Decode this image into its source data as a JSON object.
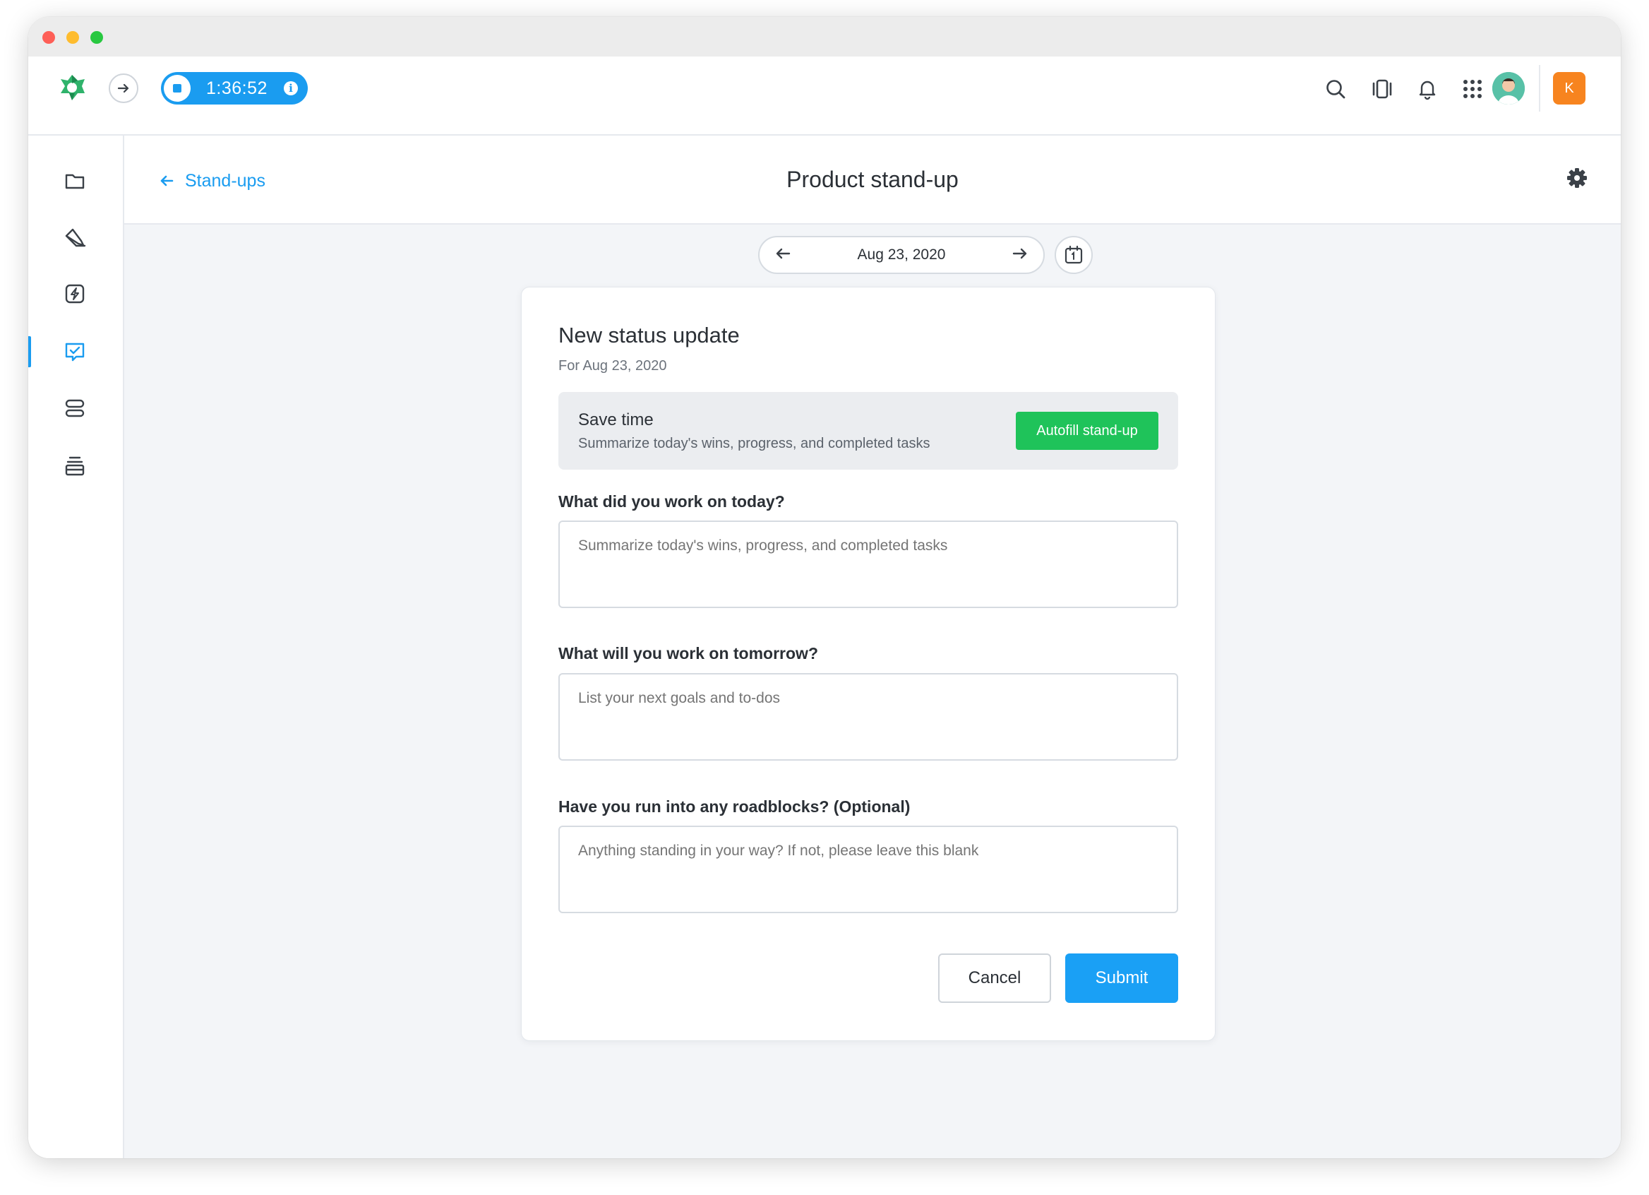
{
  "timer": {
    "time": "1:36:52",
    "info": "i"
  },
  "header": {
    "back_label": "Stand-ups",
    "title": "Product stand-up"
  },
  "date_nav": {
    "date": "Aug 23, 2020"
  },
  "org_badge": "K",
  "card": {
    "title": "New status update",
    "subtitle": "For Aug 23, 2020",
    "autofill": {
      "title": "Save time",
      "description": "Summarize today's wins, progress, and completed tasks",
      "button": "Autofill stand-up"
    },
    "questions": [
      {
        "label": "What did you work on today?",
        "placeholder": "Summarize today's wins, progress, and completed tasks"
      },
      {
        "label": "What will you work on tomorrow?",
        "placeholder": "List your next goals and to-dos"
      },
      {
        "label": "Have you run into any roadblocks? (Optional)",
        "placeholder": "Anything standing in your way? If not, please leave this blank"
      }
    ],
    "cancel": "Cancel",
    "submit": "Submit"
  },
  "colors": {
    "accent": "#1a9cf0",
    "success": "#1fc35a",
    "badge": "#f7841f"
  },
  "icons": {
    "sidebar": [
      "folder-icon",
      "pencil-icon",
      "lightning-icon",
      "checklist-icon",
      "list-icon",
      "stack-icon"
    ],
    "topbar": [
      "search-icon",
      "activity-icon",
      "bell-icon",
      "apps-grid-icon"
    ]
  }
}
